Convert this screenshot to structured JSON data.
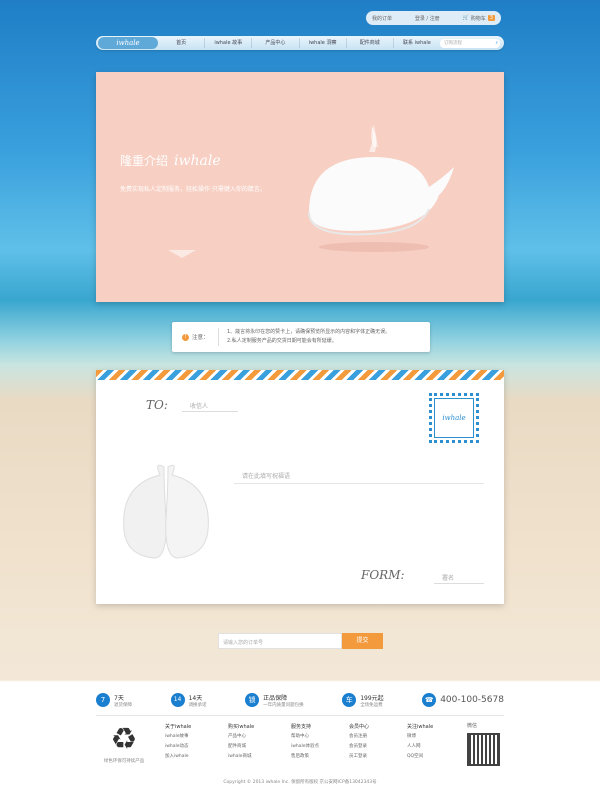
{
  "top": {
    "orders": "我的订单",
    "login": "登录 / 注册",
    "cart_label": "购物车",
    "cart_count": "3"
  },
  "nav": {
    "logo": "iwhale",
    "items": [
      "首页",
      "iwhale 故事",
      "产品中心",
      "iwhale 洞察",
      "配件商城",
      "联系 iwhale"
    ],
    "search_placeholder": "订购流程"
  },
  "banner": {
    "title": "隆重介绍",
    "brand": "iwhale",
    "desc": "免费实现私人定制服务，轻松操作·只需键入你的箴言。"
  },
  "notice": {
    "label": "注意：",
    "line1": "1、箴言将永印在您的赞卡上，请确保预览所显示的内容和字体正确无误。",
    "line2": "2.私人定制服务产品的交货日期可能会有所延缓。"
  },
  "card": {
    "to": "TO:",
    "to_placeholder": "收信人",
    "stamp": "iwhale",
    "message_placeholder": "请在此填写祝福语",
    "from": "FORM:",
    "name_placeholder": "署名"
  },
  "order": {
    "placeholder": "请输入您的订单号",
    "button": "提交"
  },
  "features": [
    {
      "icon": "7",
      "t1": "7天",
      "t2": "退货保障"
    },
    {
      "icon": "14",
      "t1": "14天",
      "t2": "调换承诺"
    },
    {
      "icon": "锁",
      "t1": "正品保障",
      "t2": "一年内质量问题包换"
    },
    {
      "icon": "车",
      "t1": "199元起",
      "t2": "全场免运费"
    }
  ],
  "phone": "400-100-5678",
  "recycle_caption": "绿色环保可持续产品",
  "columns": [
    {
      "h": "关于iwhale",
      "items": [
        "iwhale故事",
        "iwhale动态",
        "加入iwhale"
      ]
    },
    {
      "h": "购买iwhale",
      "items": [
        "产品中心",
        "配件商城",
        "iwhale商城"
      ]
    },
    {
      "h": "服务支持",
      "items": [
        "帮助中心",
        "iwhale体验点",
        "售后政策"
      ]
    },
    {
      "h": "会员中心",
      "items": [
        "会员注册",
        "会员登录",
        "员工登录"
      ]
    },
    {
      "h": "关注iwhale",
      "items": [
        "微博",
        "人人网",
        "QQ空间"
      ]
    }
  ],
  "qr_label": "微信",
  "copyright": "Copyright © 2013 iwhale Inc. 保留所有版权  京公安网ICP备13042343号",
  "colors": {
    "accent": "#f39a3c",
    "blue": "#1b7fcf",
    "banner_bg": "#f7cfc3"
  }
}
